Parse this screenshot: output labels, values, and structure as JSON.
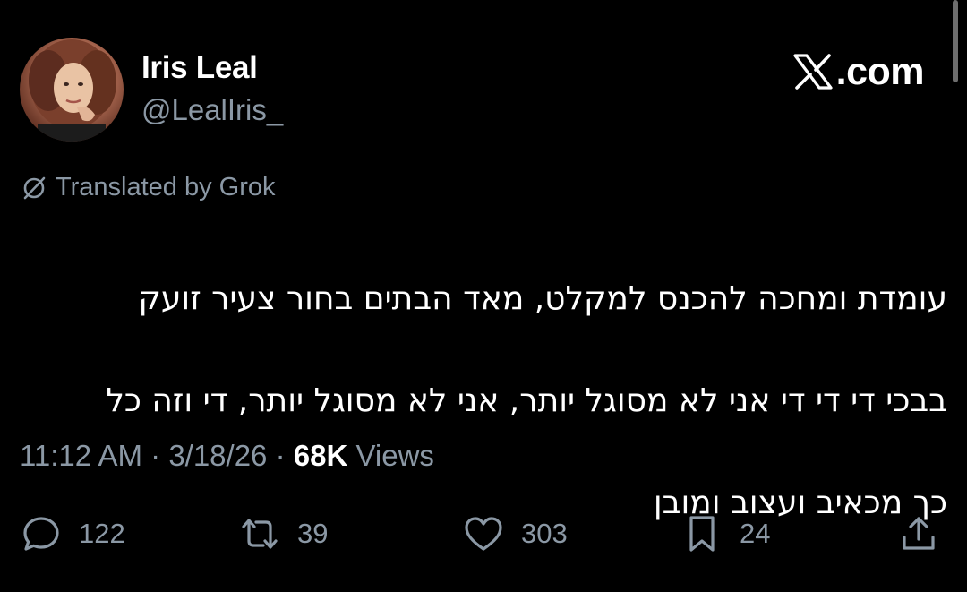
{
  "author": {
    "display_name": "Iris Leal",
    "handle": "@LealIris_"
  },
  "brand": {
    "text": ".com",
    "logo_icon": "x-logo-icon"
  },
  "translation": {
    "label": "Translated by Grok",
    "icon": "translate-slash-icon"
  },
  "tweet": {
    "lines": [
      "עומדת ומחכה להכנס למקלט, מאד הבתים בחור צעיר זועק",
      "בבכי  די די די אני לא מסוגל יותר, אני לא מסוגל יותר, די וזה כל",
      "כך מכאיב ועצוב ומובן"
    ]
  },
  "meta": {
    "time": "11:12 AM",
    "separator": " · ",
    "date": "3/18/26",
    "views_count": "68K",
    "views_label": " Views"
  },
  "actions": {
    "replies": "122",
    "reposts": "39",
    "likes": "303",
    "bookmarks": "24"
  },
  "colors": {
    "background": "#000000",
    "primary_text": "#ffffff",
    "secondary_text": "#8b98a5"
  }
}
